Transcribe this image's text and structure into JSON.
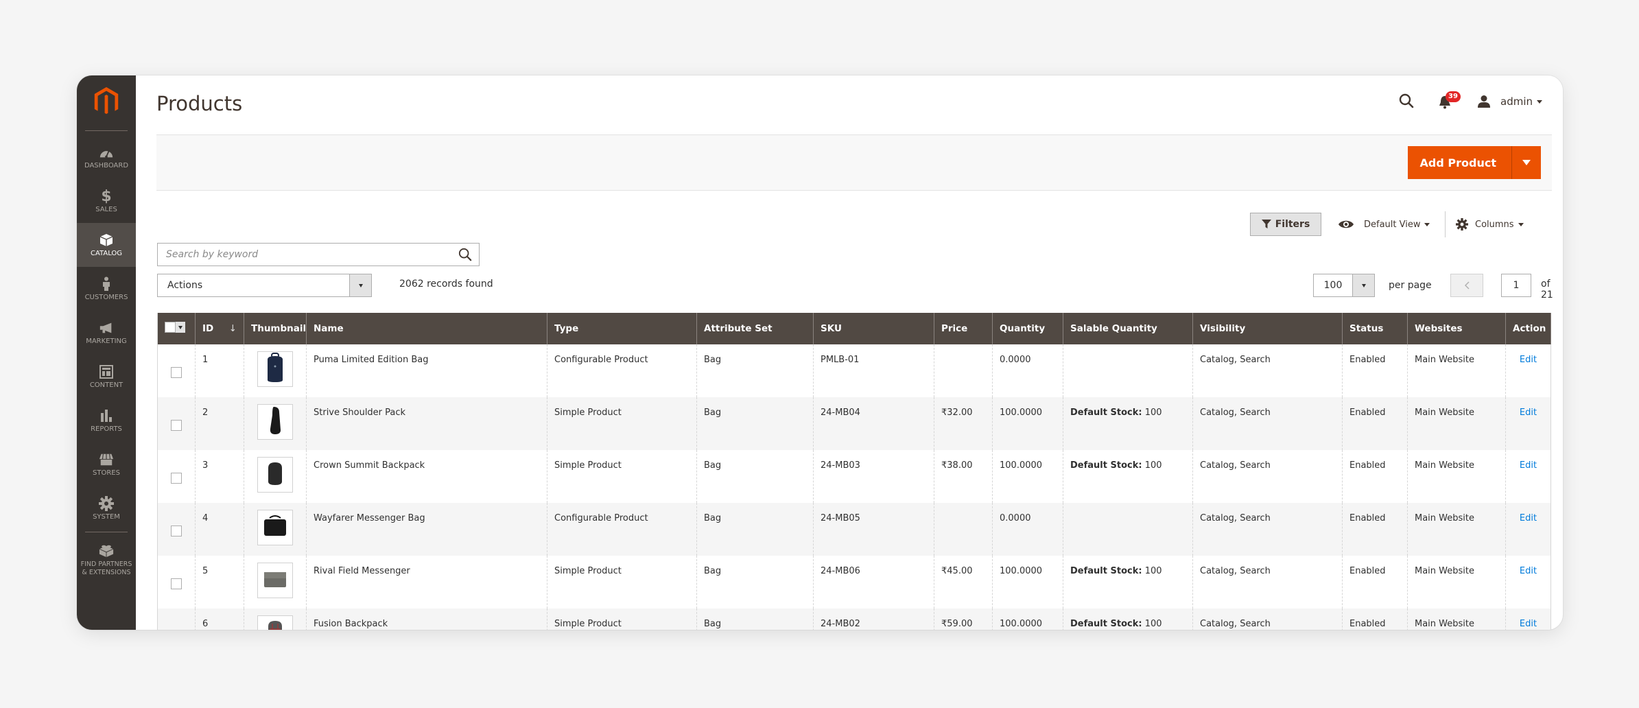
{
  "sidebar": {
    "logo": "magento-logo",
    "items": [
      {
        "label": "Dashboard",
        "icon": "dashboard-icon",
        "active": false
      },
      {
        "label": "Sales",
        "icon": "dollar-icon",
        "active": false
      },
      {
        "label": "Catalog",
        "icon": "box-icon",
        "active": true
      },
      {
        "label": "Customers",
        "icon": "person-icon",
        "active": false
      },
      {
        "label": "Marketing",
        "icon": "megaphone-icon",
        "active": false
      },
      {
        "label": "Content",
        "icon": "layout-icon",
        "active": false
      },
      {
        "label": "Reports",
        "icon": "bar-chart-icon",
        "active": false
      },
      {
        "label": "Stores",
        "icon": "storefront-icon",
        "active": false
      },
      {
        "label": "System",
        "icon": "gear-icon",
        "active": false
      }
    ],
    "partners": {
      "line1": "Find Partners",
      "line2": "& Extensions",
      "icon": "lego-brick-icon"
    }
  },
  "header": {
    "title": "Products",
    "notifications_count": "39",
    "user_name": "admin"
  },
  "page_actions": {
    "add_product_label": "Add Product"
  },
  "toolbar": {
    "filters_label": "Filters",
    "view_label": "Default View",
    "columns_label": "Columns",
    "search_placeholder": "Search by keyword",
    "search_value": "",
    "actions_label": "Actions",
    "records_found": "2062 records found",
    "per_page_value": "100",
    "per_page_label": "per page",
    "current_page": "1",
    "total_pages_label": "of 21"
  },
  "table": {
    "columns": [
      "ID",
      "Thumbnail",
      "Name",
      "Type",
      "Attribute Set",
      "SKU",
      "Price",
      "Quantity",
      "Salable Quantity",
      "Visibility",
      "Status",
      "Websites",
      "Action"
    ],
    "sorted_column": "ID",
    "sort_direction": "descending-arrow",
    "rows": [
      {
        "id": "1",
        "thumb": "navy-backpack",
        "name": "Puma Limited Edition Bag",
        "type": "Configurable Product",
        "attribute_set": "Bag",
        "sku": "PMLB-01",
        "price": "",
        "quantity": "0.0000",
        "salable_label": "",
        "salable_value": "",
        "visibility": "Catalog, Search",
        "status": "Enabled",
        "websites": "Main Website",
        "action": "Edit"
      },
      {
        "id": "2",
        "thumb": "black-sling-pack",
        "name": "Strive Shoulder Pack",
        "type": "Simple Product",
        "attribute_set": "Bag",
        "sku": "24-MB04",
        "price": "₹32.00",
        "quantity": "100.0000",
        "salable_label": "Default Stock:",
        "salable_value": "100",
        "visibility": "Catalog, Search",
        "status": "Enabled",
        "websites": "Main Website",
        "action": "Edit"
      },
      {
        "id": "3",
        "thumb": "black-backpack",
        "name": "Crown Summit Backpack",
        "type": "Simple Product",
        "attribute_set": "Bag",
        "sku": "24-MB03",
        "price": "₹38.00",
        "quantity": "100.0000",
        "salable_label": "Default Stock:",
        "salable_value": "100",
        "visibility": "Catalog, Search",
        "status": "Enabled",
        "websites": "Main Website",
        "action": "Edit"
      },
      {
        "id": "4",
        "thumb": "black-messenger",
        "name": "Wayfarer Messenger Bag",
        "type": "Configurable Product",
        "attribute_set": "Bag",
        "sku": "24-MB05",
        "price": "",
        "quantity": "0.0000",
        "salable_label": "",
        "salable_value": "",
        "visibility": "Catalog, Search",
        "status": "Enabled",
        "websites": "Main Website",
        "action": "Edit"
      },
      {
        "id": "5",
        "thumb": "gray-messenger",
        "name": "Rival Field Messenger",
        "type": "Simple Product",
        "attribute_set": "Bag",
        "sku": "24-MB06",
        "price": "₹45.00",
        "quantity": "100.0000",
        "salable_label": "Default Stock:",
        "salable_value": "100",
        "visibility": "Catalog, Search",
        "status": "Enabled",
        "websites": "Main Website",
        "action": "Edit"
      },
      {
        "id": "6",
        "thumb": "plaid-backpack",
        "name": "Fusion Backpack",
        "type": "Simple Product",
        "attribute_set": "Bag",
        "sku": "24-MB02",
        "price": "₹59.00",
        "quantity": "100.0000",
        "salable_label": "Default Stock:",
        "salable_value": "100",
        "visibility": "Catalog, Search",
        "status": "Enabled",
        "websites": "Main Website",
        "action": "Edit"
      }
    ]
  },
  "colors": {
    "brand_orange": "#eb5202",
    "sidebar_bg": "#373330",
    "header_row_bg": "#514943",
    "link_blue": "#007bdb",
    "badge_red": "#e22626"
  }
}
